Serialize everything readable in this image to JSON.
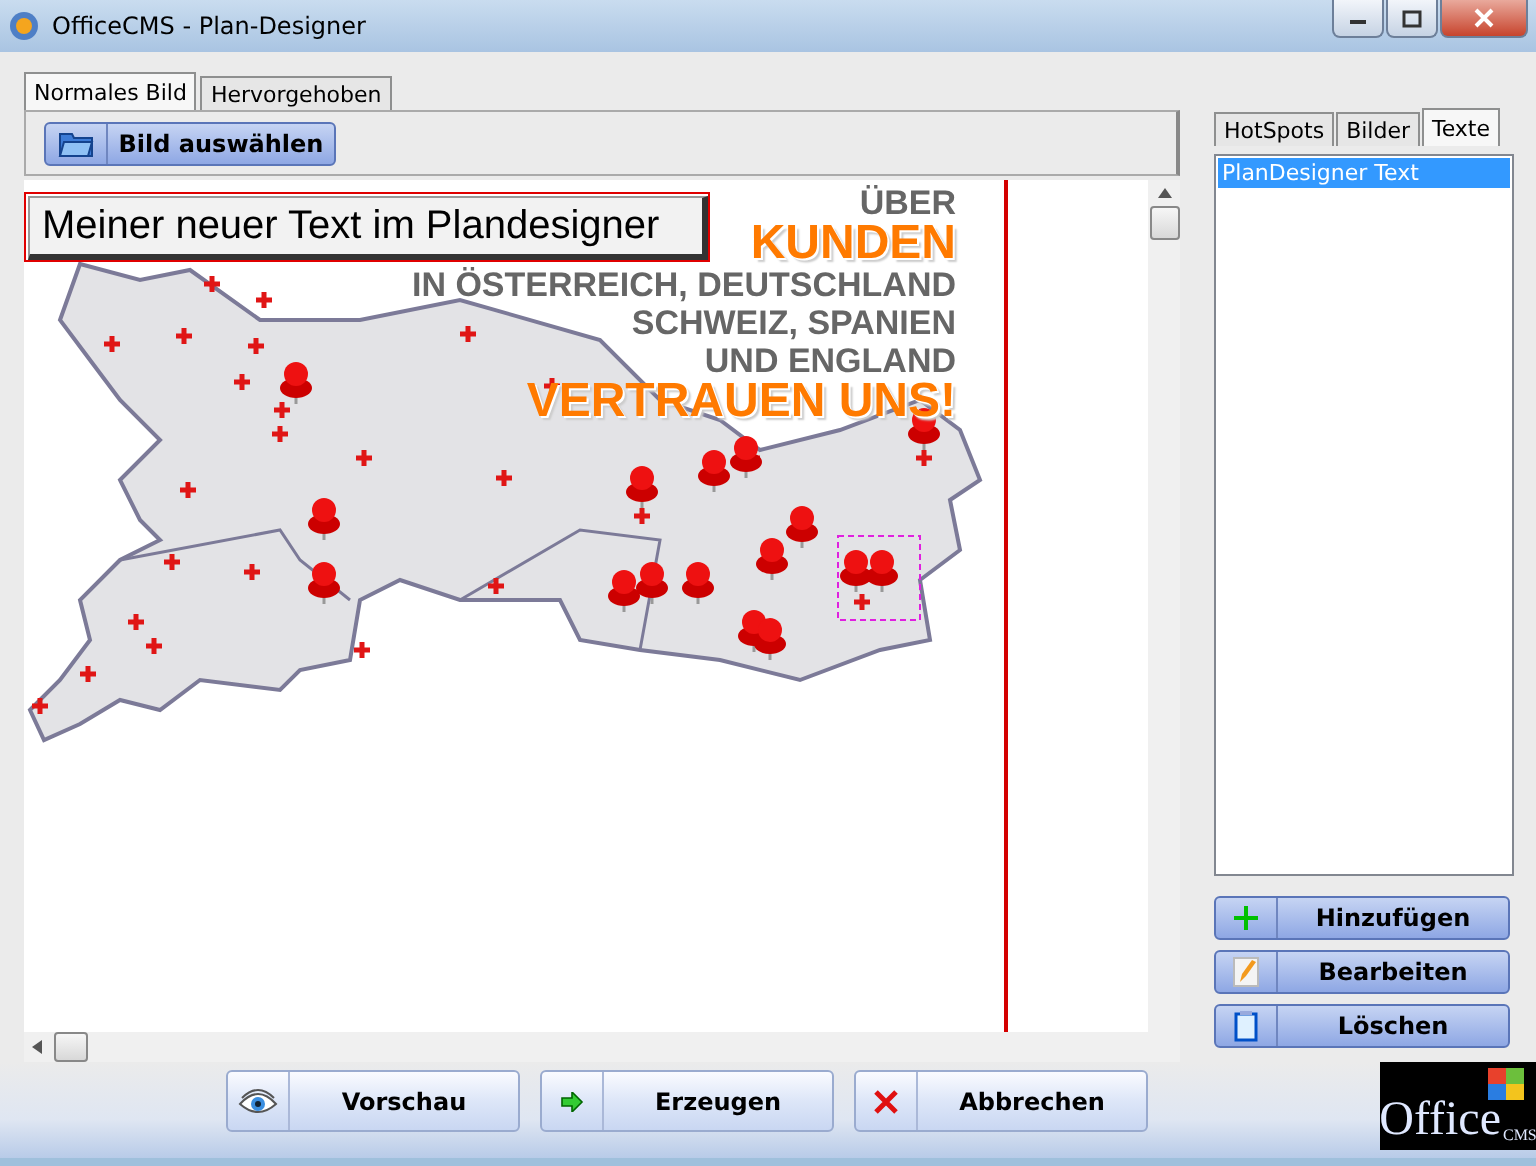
{
  "window": {
    "title": "OfficeCMS - Plan-Designer"
  },
  "image_tabs": [
    {
      "label": "Normales Bild",
      "selected": true
    },
    {
      "label": "Hervorgehoben",
      "selected": false
    }
  ],
  "select_image_button": "Bild auswählen",
  "canvas": {
    "text_element": {
      "text": "Meiner neuer Text im Plandesigner",
      "selected": true
    },
    "headline": [
      {
        "text": "ÜBER",
        "kind": "plain"
      },
      {
        "text": "KUNDEN",
        "kind": "accent"
      },
      {
        "text": "IN ÖSTERREICH, DEUTSCHLAND",
        "kind": "plain"
      },
      {
        "text": "SCHWEIZ, SPANIEN",
        "kind": "plain"
      },
      {
        "text": "UND ENGLAND",
        "kind": "plain"
      },
      {
        "text": "VERTRAUEN UNS!",
        "kind": "accent"
      }
    ]
  },
  "side_tabs": [
    {
      "label": "HotSpots",
      "selected": false
    },
    {
      "label": "Bilder",
      "selected": false
    },
    {
      "label": "Texte",
      "selected": true
    }
  ],
  "texts_list": [
    {
      "label": "PlanDesigner Text",
      "selected": true
    }
  ],
  "side_buttons": [
    {
      "label": "Hinzufügen",
      "kind": "add"
    },
    {
      "label": "Bearbeiten",
      "kind": "edit"
    },
    {
      "label": "Löschen",
      "kind": "delete"
    }
  ],
  "footer_buttons": [
    {
      "label": "Vorschau",
      "kind": "preview"
    },
    {
      "label": "Erzeugen",
      "kind": "generate"
    },
    {
      "label": "Abbrechen",
      "kind": "cancel"
    }
  ],
  "logo": {
    "text": "Office",
    "sub": "CMS"
  }
}
